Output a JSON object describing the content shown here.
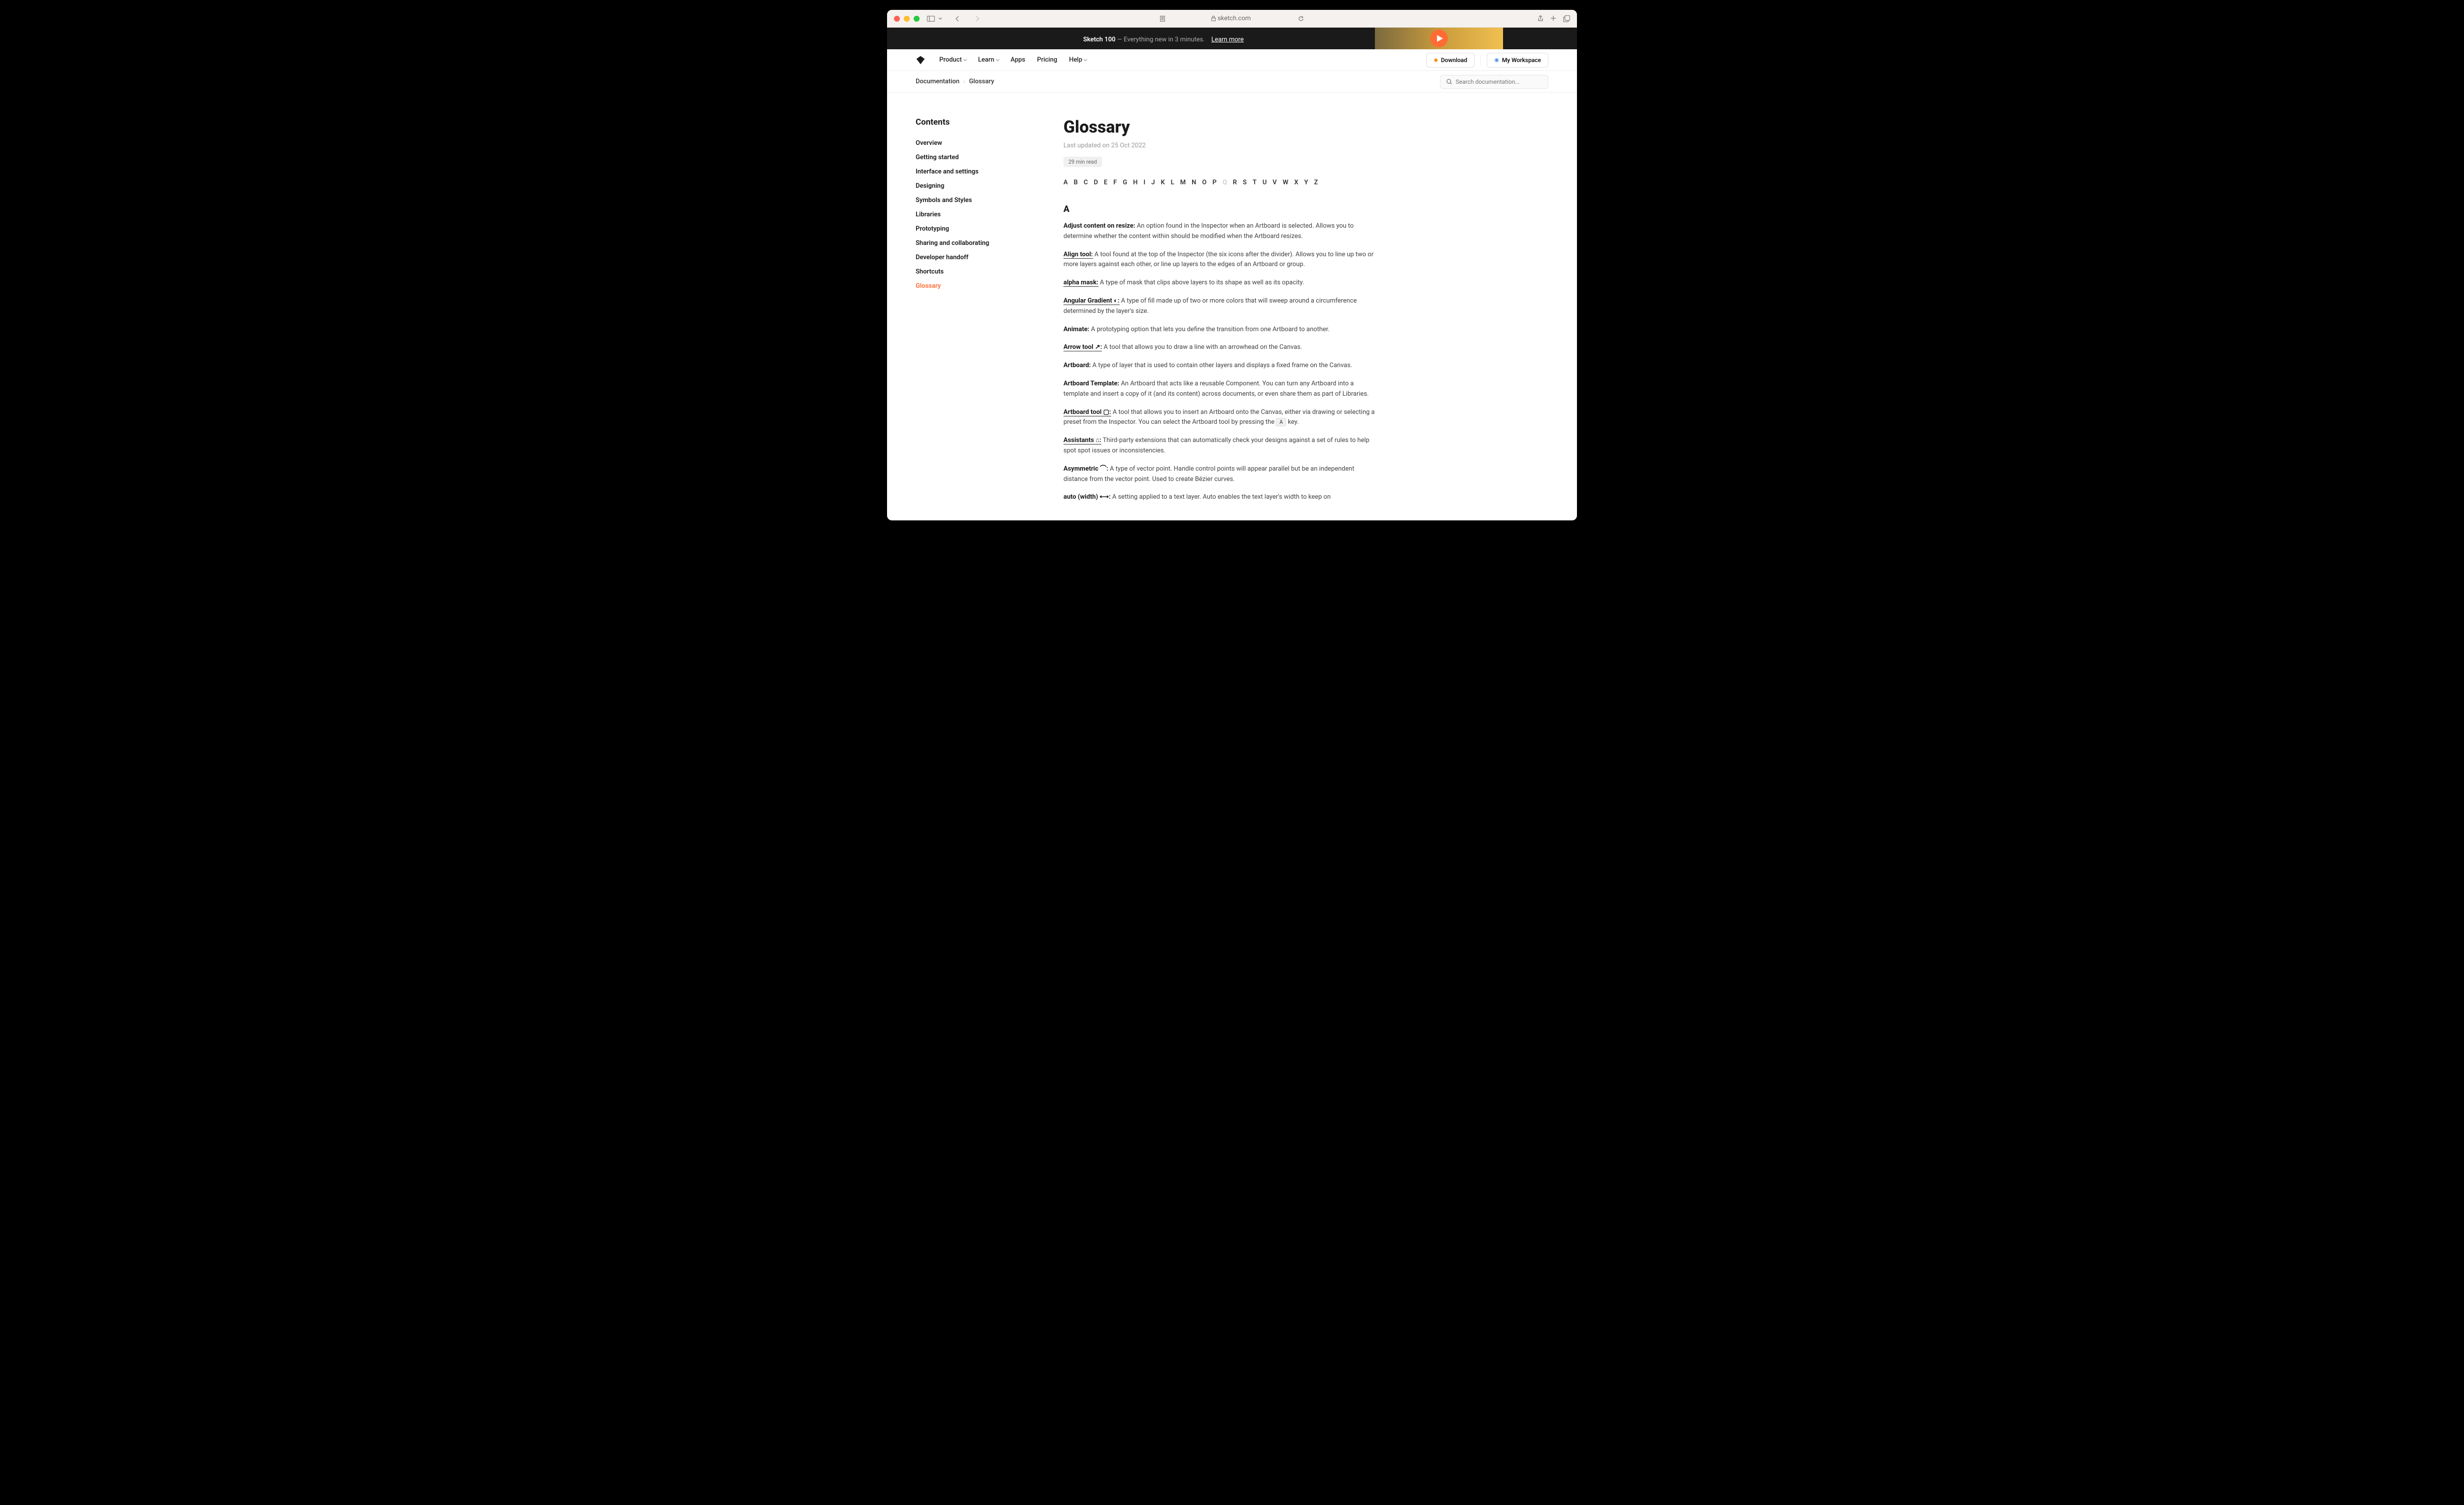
{
  "titlebar": {
    "url": "sketch.com"
  },
  "banner": {
    "title": "Sketch 100",
    "subtitle": "— Everything new in 3 minutes.",
    "link": "Learn more"
  },
  "nav": {
    "items": [
      "Product",
      "Learn",
      "Apps",
      "Pricing",
      "Help"
    ],
    "download": "Download",
    "workspace": "My Workspace"
  },
  "breadcrumb": {
    "root": "Documentation",
    "current": "Glossary"
  },
  "search": {
    "placeholder": "Search documentation..."
  },
  "sidebar": {
    "title": "Contents",
    "items": [
      "Overview",
      "Getting started",
      "Interface and settings",
      "Designing",
      "Symbols and Styles",
      "Libraries",
      "Prototyping",
      "Sharing and collaborating",
      "Developer handoff",
      "Shortcuts",
      "Glossary"
    ]
  },
  "page": {
    "title": "Glossary",
    "updated": "Last updated on 25 Oct 2022",
    "readtime": "29 min read"
  },
  "alphabet": [
    "A",
    "B",
    "C",
    "D",
    "E",
    "F",
    "G",
    "H",
    "I",
    "J",
    "K",
    "L",
    "M",
    "N",
    "O",
    "P",
    "Q",
    "R",
    "S",
    "T",
    "U",
    "V",
    "W",
    "X",
    "Y",
    "Z"
  ],
  "alphabet_disabled": [
    "Q"
  ],
  "section": {
    "letter": "A"
  },
  "entries": [
    {
      "term": "Adjust content on resize:",
      "desc": " An option found in the Inspector when an Artboard is selected. Allows you to determine whether the content within should be modified when the Artboard resizes.",
      "link": false
    },
    {
      "term": "Align tool:",
      "desc": " A tool found at the top of the Inspector (the six icons after the divider). Allows you to line up two or more layers against each other, or line up layers to the edges of an Artboard or group.",
      "link": true
    },
    {
      "term": "alpha mask:",
      "desc": " A type of mask that clips above layers to its shape as well as its opacity.",
      "link": true
    },
    {
      "term": "Angular Gradient ◐:",
      "desc": " A type of fill made up of two or more colors that will sweep around a circumference determined by the layer's size.",
      "link": true
    },
    {
      "term": "Animate:",
      "desc": " A prototyping option that lets you define the transition from one Artboard to another.",
      "link": false
    },
    {
      "term": "Arrow tool ↗:",
      "desc": " A tool that allows you to draw a line with an arrowhead on the Canvas.",
      "link": true
    },
    {
      "term": "Artboard:",
      "desc": " A type of layer that is used to contain other layers and displays a fixed frame on the Canvas.",
      "link": false
    },
    {
      "term": "Artboard Template:",
      "desc": " An Artboard that acts like a reusable Component. You can turn any Artboard into a template and insert a copy of it (and its content) across documents, or even share them as part of Libraries.",
      "link": false
    },
    {
      "term": "Artboard tool ▢:",
      "desc": " A tool that allows you to insert an Artboard onto the Canvas, either via drawing or selecting a preset from the Inspector. You can select the Artboard tool by pressing the ",
      "link": true,
      "key": "A",
      "suffix": " key."
    },
    {
      "term": "Assistants ⌂:",
      "desc": " Third-party extensions that can automatically check your designs against a set of rules to help spot spot issues or inconsistencies.",
      "link": true
    },
    {
      "term": "Asymmetric ⌒:",
      "desc": " A type of vector point. Handle control points will appear parallel but be an independent distance from the vector point. Used to create Bézier curves.",
      "link": false
    },
    {
      "term": "auto (width) ⟷:",
      "desc": " A setting applied to a text layer. Auto enables the text layer's width to keep on",
      "link": false
    }
  ]
}
